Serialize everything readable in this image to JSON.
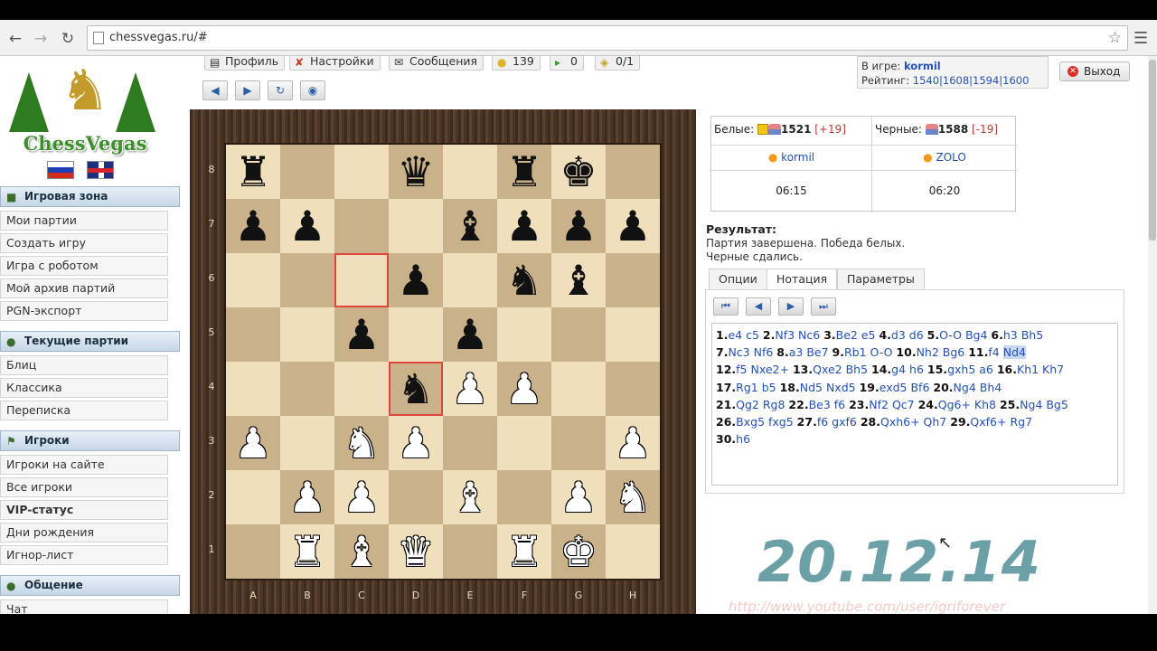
{
  "browser": {
    "url": "chessvegas.ru/#"
  },
  "logo": {
    "text": "ChessVegas"
  },
  "sidebar": {
    "sections": [
      {
        "title": "Игровая зона",
        "items": [
          "Мои партии",
          "Создать игру",
          "Игра с роботом",
          "Мой архив партий",
          "PGN-экспорт"
        ]
      },
      {
        "title": "Текущие партии",
        "items": [
          "Блиц",
          "Классика",
          "Переписка"
        ]
      },
      {
        "title": "Игроки",
        "items": [
          "Игроки на сайте",
          "Все игроки",
          "VIP-статус",
          "Дни рождения",
          "Игнор-лист"
        ]
      },
      {
        "title": "Общение",
        "items": [
          "Чат"
        ]
      }
    ]
  },
  "topbar": {
    "profile": "Профиль",
    "settings": "Настройки",
    "messages": "Сообщения",
    "count_coins": "139",
    "count_msgs": "0",
    "count_games": "0/1",
    "ingame_label": "В игре:",
    "ingame_user": "kormil",
    "rating_label": "Рейтинг:",
    "ratings": "1540|1608|1594|1600",
    "exit": "Выход"
  },
  "players": {
    "white_label": "Белые:",
    "white_rating": "1521",
    "white_delta": "[+19]",
    "black_label": "Черные:",
    "black_rating": "1588",
    "black_delta": "[-19]",
    "white_name": "kormil",
    "black_name": "ZOLO",
    "white_clock": "06:15",
    "black_clock": "06:20"
  },
  "result": {
    "title": "Результат:",
    "line1": "Партия завершена. Победа белых.",
    "line2": "Черные сдались."
  },
  "tabs": [
    "Опции",
    "Нотация",
    "Параметры"
  ],
  "notation": [
    [
      "1.",
      "e4 c5",
      "2.",
      "Nf3 Nc6",
      "3.",
      "Be2 e5",
      "4.",
      "d3 d6",
      "5.",
      "O-O Bg4",
      "6.",
      "h3 Bh5"
    ],
    [
      "7.",
      "Nc3 Nf6",
      "8.",
      "a3 Be7",
      "9.",
      "Rb1 O-O",
      "10.",
      "Nh2 Bg6",
      "11.",
      "f4 Nd4"
    ],
    [
      "12.",
      "f5 Nxe2+",
      "13.",
      "Qxe2 Bh5",
      "14.",
      "g4 h6",
      "15.",
      "gxh5 a6",
      "16.",
      "Kh1 Kh7"
    ],
    [
      "17.",
      "Rg1 b5",
      "18.",
      "Nd5 Nxd5",
      "19.",
      "exd5 Bf6",
      "20.",
      "Ng4 Bh4"
    ],
    [
      "21.",
      "Qg2 Rg8",
      "22.",
      "Be3 f6",
      "23.",
      "Nf2 Qc7",
      "24.",
      "Qg6+ Kh8",
      "25.",
      "Ng4 Bg5"
    ],
    [
      "26.",
      "Bxg5 fxg5",
      "27.",
      "f6 gxf6",
      "28.",
      "Qxh6+ Qh7",
      "29.",
      "Qxf6+ Rg7"
    ],
    [
      "30.",
      "h6"
    ]
  ],
  "board": {
    "files": [
      "A",
      "B",
      "C",
      "D",
      "E",
      "F",
      "G",
      "H"
    ],
    "ranks": [
      "8",
      "7",
      "6",
      "5",
      "4",
      "3",
      "2",
      "1"
    ],
    "highlighted": [
      "c6",
      "d4"
    ],
    "pieces": [
      {
        "sq": "a8",
        "p": "r",
        "c": "b"
      },
      {
        "sq": "d8",
        "p": "q",
        "c": "b"
      },
      {
        "sq": "f8",
        "p": "r",
        "c": "b"
      },
      {
        "sq": "g8",
        "p": "k",
        "c": "b"
      },
      {
        "sq": "a7",
        "p": "p",
        "c": "b"
      },
      {
        "sq": "b7",
        "p": "p",
        "c": "b"
      },
      {
        "sq": "e7",
        "p": "b",
        "c": "b"
      },
      {
        "sq": "f7",
        "p": "p",
        "c": "b"
      },
      {
        "sq": "g7",
        "p": "p",
        "c": "b"
      },
      {
        "sq": "h7",
        "p": "p",
        "c": "b"
      },
      {
        "sq": "d6",
        "p": "p",
        "c": "b"
      },
      {
        "sq": "f6",
        "p": "n",
        "c": "b"
      },
      {
        "sq": "g6",
        "p": "b",
        "c": "b"
      },
      {
        "sq": "c5",
        "p": "p",
        "c": "b"
      },
      {
        "sq": "e5",
        "p": "p",
        "c": "b"
      },
      {
        "sq": "d4",
        "p": "n",
        "c": "b"
      },
      {
        "sq": "e4",
        "p": "p",
        "c": "w"
      },
      {
        "sq": "f4",
        "p": "p",
        "c": "w"
      },
      {
        "sq": "a3",
        "p": "p",
        "c": "w"
      },
      {
        "sq": "c3",
        "p": "n",
        "c": "w"
      },
      {
        "sq": "d3",
        "p": "p",
        "c": "w"
      },
      {
        "sq": "h3",
        "p": "p",
        "c": "w"
      },
      {
        "sq": "b2",
        "p": "p",
        "c": "w"
      },
      {
        "sq": "c2",
        "p": "p",
        "c": "w"
      },
      {
        "sq": "e2",
        "p": "b",
        "c": "w"
      },
      {
        "sq": "g2",
        "p": "p",
        "c": "w"
      },
      {
        "sq": "h2",
        "p": "n",
        "c": "w"
      },
      {
        "sq": "b1",
        "p": "r",
        "c": "w"
      },
      {
        "sq": "c1",
        "p": "b",
        "c": "w"
      },
      {
        "sq": "d1",
        "p": "q",
        "c": "w"
      },
      {
        "sq": "f1",
        "p": "r",
        "c": "w"
      },
      {
        "sq": "g1",
        "p": "k",
        "c": "w"
      }
    ]
  },
  "date_stamp": "20.12.14",
  "watermark": "http://www.youtube.com/user/igriforever"
}
